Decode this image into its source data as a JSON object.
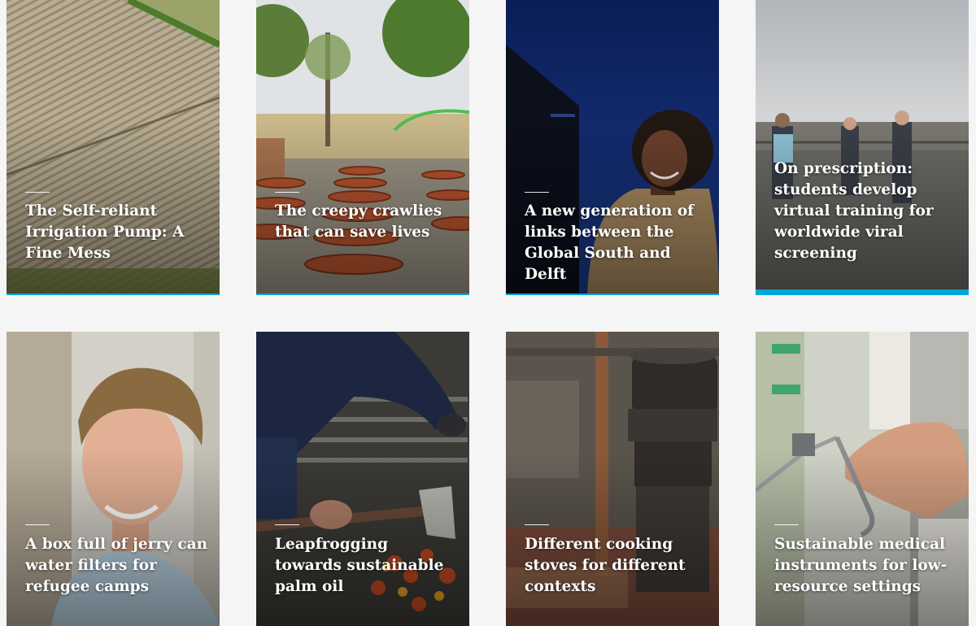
{
  "colors": {
    "background": "#f5f5f5",
    "accent": "#00a6d6",
    "title_text": "#ffffff"
  },
  "cards": [
    {
      "title": "The Self-reliant Irrigation Pump: A Fine Mess",
      "image": "aerial-irrigated-field-image"
    },
    {
      "title": "The creepy crawlies that can save lives",
      "image": "clay-pots-garden-image"
    },
    {
      "title": "A new generation of links between the Global South and Delft",
      "image": "smiling-student-portrait-image"
    },
    {
      "title": "On prescription: students develop virtual training for worldwide viral screening",
      "image": "students-on-rooftop-image"
    },
    {
      "title": "A box full of jerry can water filters for refugee camps",
      "image": "smiling-man-portrait-image"
    },
    {
      "title": "Leapfrogging towards sustainable palm oil",
      "image": "palm-fruit-harvest-image"
    },
    {
      "title": "Different cooking stoves for different contexts",
      "image": "cooking-stove-workshop-image"
    },
    {
      "title": "Sustainable medical instruments for low-resource settings",
      "image": "medical-instrument-hand-image"
    }
  ]
}
